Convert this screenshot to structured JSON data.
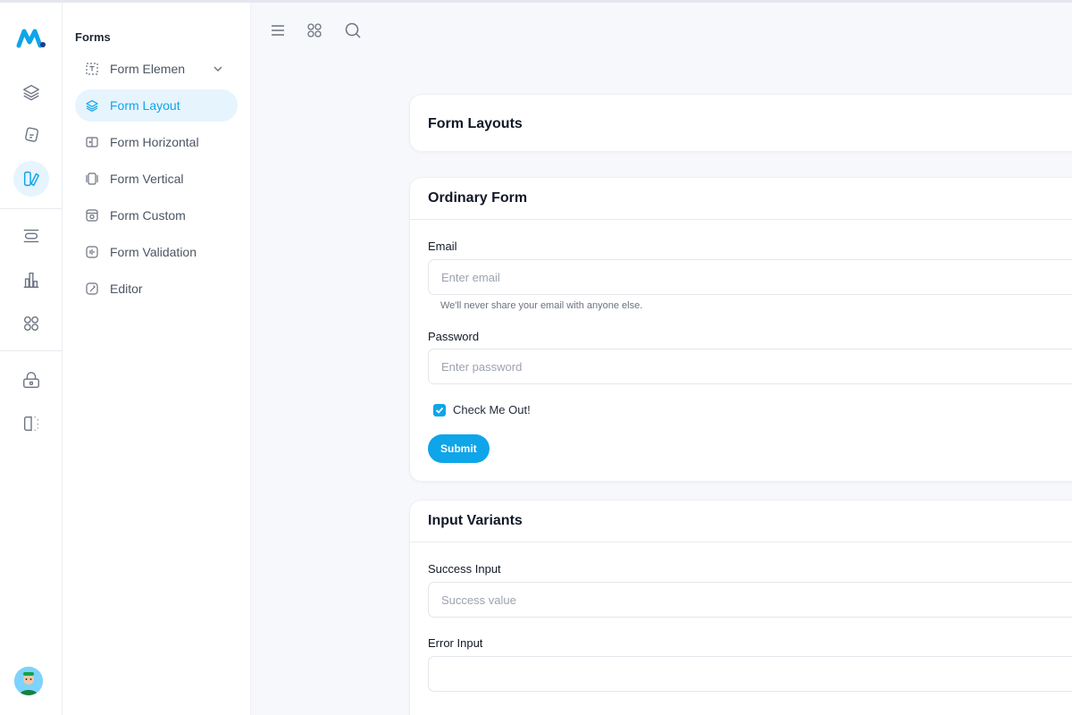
{
  "sidebar": {
    "section_title": "Forms",
    "items": [
      {
        "label": "Form Elemen",
        "icon": "text-box-icon"
      },
      {
        "label": "Form Layout",
        "icon": "layers-icon"
      },
      {
        "label": "Form Horizontal",
        "icon": "columns-icon"
      },
      {
        "label": "Form Vertical",
        "icon": "rows-icon"
      },
      {
        "label": "Form Custom",
        "icon": "custom-icon"
      },
      {
        "label": "Form Validation",
        "icon": "validation-icon"
      },
      {
        "label": "Editor",
        "icon": "editor-icon"
      }
    ]
  },
  "header": {
    "title": "Form Layouts"
  },
  "ordinary_form": {
    "title": "Ordinary Form",
    "email_label": "Email",
    "email_placeholder": "Enter email",
    "email_help": "We'll never share your email with anyone else.",
    "password_label": "Password",
    "password_placeholder": "Enter password",
    "checkbox_label": "Check Me Out!",
    "checkbox_checked": true,
    "submit_label": "Submit"
  },
  "input_variants": {
    "title": "Input Variants",
    "success_label": "Success Input",
    "success_placeholder": "Success value",
    "error_label": "Error Input"
  },
  "colors": {
    "accent": "#0ea5e9",
    "active_bg": "#e6f4fd"
  }
}
